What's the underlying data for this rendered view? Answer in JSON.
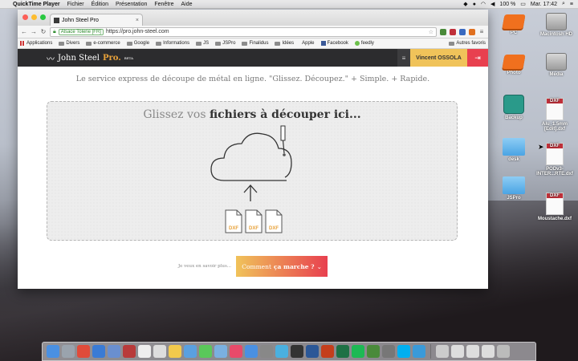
{
  "menubar": {
    "app_name": "QuickTime Player",
    "items": [
      "Fichier",
      "Édition",
      "Présentation",
      "Fenêtre",
      "Aide"
    ],
    "battery": "100 %",
    "clock": "Mar. 17:42"
  },
  "browser": {
    "tab_title": "John Steel Pro",
    "security_label": "Alsace Tolerie [FR]",
    "url": "https://pro.john-steel.com",
    "bookmarks": [
      "Applications",
      "Divers",
      "e-commerce",
      "Google",
      "Informations",
      "JS",
      "JSPro",
      "Finalidus",
      "Idées",
      "Apple",
      "Facebook",
      "feedly"
    ],
    "other_bookmarks": "Autres favoris"
  },
  "site": {
    "logo_text": "John Steel",
    "logo_pro": "Pro.",
    "logo_beta": "BETA",
    "user_name": "Vincent OSSOLA",
    "tagline": "Le service express de découpe de métal en ligne. \"Glissez. Découpez.\" + Simple. + Rapide.",
    "dropzone_prefix": "Glissez vos ",
    "dropzone_bold": "fichiers à découper ici...",
    "file_labels": [
      "DXF",
      "DXF",
      "DXF"
    ],
    "learn_more": "Je veux en savoir plus...",
    "how_button_prefix": "Comment ",
    "how_button_bold": "ça marche ?"
  },
  "desktop": {
    "icons": [
      {
        "label": "PC"
      },
      {
        "label": "Macintosh HD"
      },
      {
        "label": "Photo"
      },
      {
        "label": "Média"
      },
      {
        "label": "Backup"
      },
      {
        "label": "Alu_1.5mm [Edit].dxf"
      },
      {
        "label": "desk"
      },
      {
        "label": "PODv3-INTER...RTE.dxf"
      },
      {
        "label": "JSPro"
      },
      {
        "label": "Moustache.dxf"
      }
    ],
    "dxf_tag": "DXF"
  },
  "colors": {
    "header_bg": "#2c2c2e",
    "accent_yellow": "#f0c35a",
    "accent_red": "#e8404f",
    "accent_orange": "#e8a23a"
  }
}
